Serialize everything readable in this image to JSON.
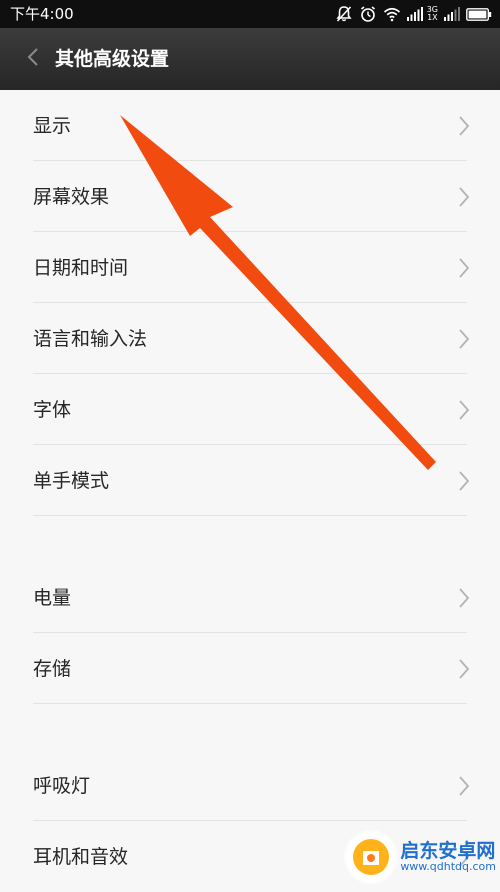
{
  "status_bar": {
    "time": "下午4:00",
    "network_top": "3G",
    "network_bottom": "1X",
    "icons": [
      "mute-icon",
      "alarm-icon",
      "wifi-icon",
      "signal-icon",
      "battery-icon"
    ]
  },
  "header": {
    "title": "其他高级设置",
    "back_icon": "chevron-left-icon"
  },
  "groups": [
    {
      "items": [
        {
          "label": "显示",
          "icon": "chevron-right-icon"
        },
        {
          "label": "屏幕效果",
          "icon": "chevron-right-icon"
        },
        {
          "label": "日期和时间",
          "icon": "chevron-right-icon"
        },
        {
          "label": "语言和输入法",
          "icon": "chevron-right-icon"
        },
        {
          "label": "字体",
          "icon": "chevron-right-icon"
        },
        {
          "label": "单手模式",
          "icon": "chevron-right-icon"
        }
      ]
    },
    {
      "items": [
        {
          "label": "电量",
          "icon": "chevron-right-icon"
        },
        {
          "label": "存储",
          "icon": "chevron-right-icon"
        }
      ]
    },
    {
      "items": [
        {
          "label": "呼吸灯",
          "icon": "chevron-right-icon"
        },
        {
          "label": "耳机和音效",
          "icon": "chevron-right-icon"
        }
      ]
    }
  ],
  "annotation": {
    "color": "#f24b0f"
  },
  "watermark": {
    "name": "启东安卓网",
    "url": "www.qdhtdq.com"
  },
  "colors": {
    "status_bar": "#0f0f0f",
    "title_bar": "#2f2f2f",
    "background": "#f7f7f7",
    "text": "#262626",
    "chevron": "#b3b3b3"
  }
}
